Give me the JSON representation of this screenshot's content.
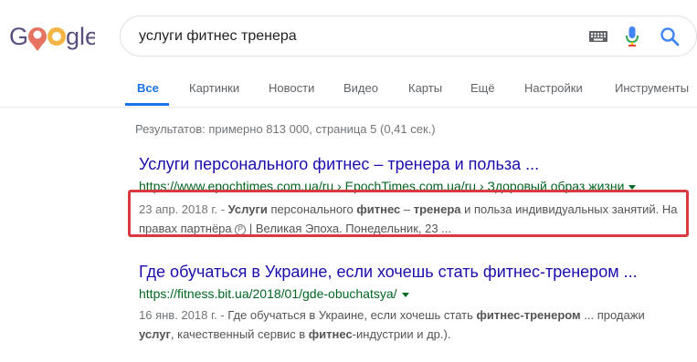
{
  "logo": {
    "text": "Google"
  },
  "search": {
    "query": "услуги фитнес тренера"
  },
  "tabs": [
    {
      "label": "Все",
      "active": true
    },
    {
      "label": "Картинки"
    },
    {
      "label": "Новости"
    },
    {
      "label": "Видео"
    },
    {
      "label": "Карты"
    },
    {
      "label": "Ещё"
    },
    {
      "label": "Настройки"
    },
    {
      "label": "Инструменты"
    }
  ],
  "stats": "Результатов: примерно 813 000, страница 5 (0,41 сек.)",
  "results": [
    {
      "title": "Услуги персонального фитнес – тренера и польза ...",
      "url": "https://www.epochtimes.com.ua/ru",
      "breadcrumb": " › EpochTimes.com.ua/ru › Здоровый образ жизни",
      "date": "23 апр. 2018 г. - ",
      "snippet_line1_parts": [
        "Услуги",
        " персонального ",
        "фитнес",
        " – ",
        "тренера",
        " и польза индивидуальных занятий. На"
      ],
      "snippet_line2_before": "правах партнёра ",
      "snippet_badge": "P",
      "snippet_line2_after": " | Великая Эпоха. Понедельник, 23 ..."
    },
    {
      "title": "Где обучаться в Украине, если хочешь стать фитнес-тренером ...",
      "url": "https://fitness.bit.ua/2018/01/gde-obuchatsya/",
      "date": "16 янв. 2018 г. - ",
      "snippet_line1_parts": [
        "Где обучаться в Украине, если хочешь стать ",
        "фитнес-тренером",
        " ... продажи"
      ],
      "snippet_line2_parts": [
        "услуг",
        ", качественный сервис в ",
        "фитнес",
        "-индустрии и др.)."
      ]
    }
  ],
  "colors": {
    "link": "#1a0dab",
    "url": "#006621",
    "accent": "#1a73e8",
    "highlight": "#d93a3f"
  },
  "icons": [
    "keyboard-icon",
    "microphone-icon",
    "search-icon",
    "dropdown-arrow-icon"
  ]
}
